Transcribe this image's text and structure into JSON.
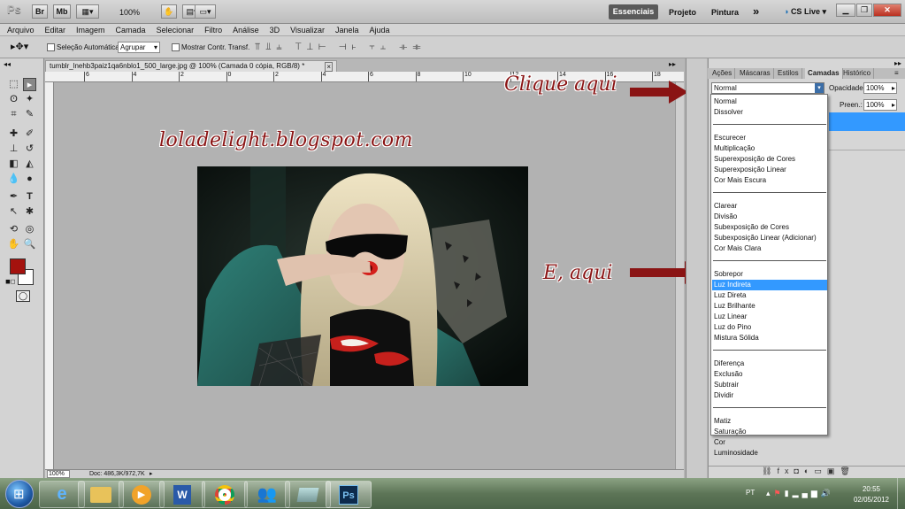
{
  "app": {
    "logo": "Ps",
    "br": "Br",
    "mb": "Mb",
    "zoom": "100%",
    "workspaces": [
      "Essenciais",
      "Projeto",
      "Pintura"
    ],
    "more": "»",
    "cslive": "CS Live"
  },
  "menu": [
    "Arquivo",
    "Editar",
    "Imagem",
    "Camada",
    "Selecionar",
    "Filtro",
    "Análise",
    "3D",
    "Visualizar",
    "Janela",
    "Ajuda"
  ],
  "options": {
    "auto_select_label": "Seleção Automática:",
    "auto_select_value": "Agrupar",
    "show_transform_label": "Mostrar Contr. Transf."
  },
  "document": {
    "tab_title": "tumblr_lnehb3paiz1qa6nblo1_500_large.jpg @ 100% (Camada 0 cópia, RGB/8) *",
    "close": "×",
    "ruler_ticks": [
      "6",
      "4",
      "2",
      "0",
      "2",
      "4",
      "6",
      "8",
      "10",
      "12",
      "14",
      "16",
      "18"
    ],
    "zoom_status": "100%",
    "doc_status": "Doc: 486,3K/972,7K",
    "watermark": "loladelight.blogspot.com"
  },
  "annotations": {
    "click_here": "Clique aqui",
    "and_here": "E, aqui"
  },
  "panel": {
    "tabs": [
      "Ações",
      "Máscaras",
      "Estilos",
      "Camadas",
      "Histórico"
    ],
    "active_tab": "Camadas",
    "blend_mode": "Normal",
    "opacity_label": "Opacidade:",
    "opacity_value": "100%",
    "fill_label": "Preen.:",
    "fill_value": "100%"
  },
  "blend_modes": [
    [
      "Normal",
      "Dissolver"
    ],
    [
      "Escurecer",
      "Multiplicação",
      "Superexposição de Cores",
      "Superexposição Linear",
      "Cor Mais Escura"
    ],
    [
      "Clarear",
      "Divisão",
      "Subexposição de Cores",
      "Subexposição Linear (Adicionar)",
      "Cor Mais Clara"
    ],
    [
      "Sobrepor",
      "Luz Indireta",
      "Luz Direta",
      "Luz Brilhante",
      "Luz Linear",
      "Luz do Pino",
      "Mistura Sólida"
    ],
    [
      "Diferença",
      "Exclusão",
      "Subtrair",
      "Dividir"
    ],
    [
      "Matiz",
      "Saturação",
      "Cor",
      "Luminosidade"
    ]
  ],
  "selected_blend": "Luz Indireta",
  "taskbar": {
    "lang": "PT",
    "time": "20:55",
    "date": "02/05/2012"
  },
  "colors": {
    "foreground": "#a4120e",
    "background": "#ffffff",
    "annotation": "#8a1414",
    "selection": "#3399ff"
  }
}
